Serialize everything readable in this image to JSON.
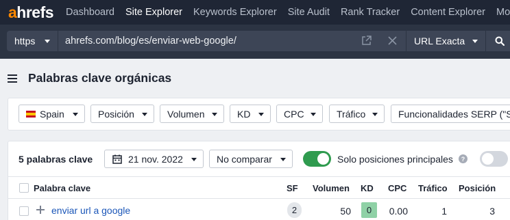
{
  "nav": {
    "logo_a": "a",
    "logo_rest": "hrefs",
    "items": [
      "Dashboard",
      "Site Explorer",
      "Keywords Explorer",
      "Site Audit",
      "Rank Tracker",
      "Content Explorer",
      "More"
    ],
    "active_index": 1
  },
  "urlbar": {
    "protocol": "https",
    "url": "ahrefs.com/blog/es/enviar-web-google/",
    "mode": "URL Exacta"
  },
  "header": {
    "title": "Palabras clave orgánicas"
  },
  "filters": {
    "country": "Spain",
    "position": "Posición",
    "volume": "Volumen",
    "kd": "KD",
    "cpc": "CPC",
    "traffic": "Tráfico",
    "serp_features": "Funcionalidades SERP (\"S"
  },
  "toolbar": {
    "count_label": "5 palabras clave",
    "date": "21 nov. 2022",
    "compare": "No comparar",
    "toggle_label": "Solo posiciones principales",
    "help": "?",
    "main_positions_only": true
  },
  "table": {
    "columns": {
      "keyword": "Palabra clave",
      "sf": "SF",
      "volume": "Volumen",
      "kd": "KD",
      "cpc": "CPC",
      "traffic": "Tráfico",
      "position": "Posición"
    },
    "rows": [
      {
        "keyword": "enviar url a google",
        "sf": "2",
        "volume": "50",
        "kd": "0",
        "cpc": "0.00",
        "traffic": "1",
        "position": "3"
      }
    ]
  },
  "colors": {
    "nav_bg": "#1f2635",
    "logo_accent": "#ff8800",
    "toggle_on": "#2f9b4f",
    "kd_low": "#8fd1a6",
    "link": "#1a56b8"
  }
}
